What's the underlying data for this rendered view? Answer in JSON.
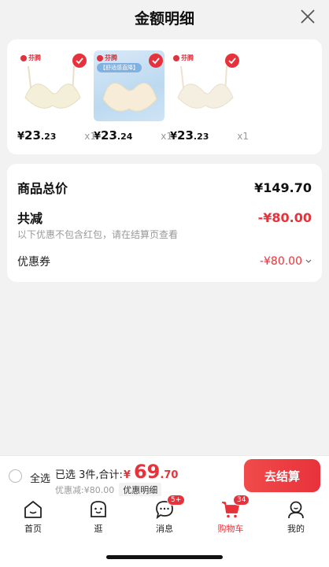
{
  "header": {
    "title": "金额明细"
  },
  "products": [
    {
      "brand": "芬腾",
      "promo": "",
      "price_symbol": "¥",
      "price_int": "23",
      "price_dec": ".23",
      "qty": "x1",
      "bg": "#ffffff"
    },
    {
      "brand": "芬腾",
      "promo": "【舒适感直降】",
      "price_symbol": "¥",
      "price_int": "23",
      "price_dec": ".24",
      "qty": "x1",
      "bg": "#cfe4f5"
    },
    {
      "brand": "芬腾",
      "promo": "",
      "price_symbol": "¥",
      "price_int": "23",
      "price_dec": ".23",
      "qty": "x1",
      "bg": "#ffffff"
    }
  ],
  "summary": {
    "goods_total_label": "商品总价",
    "goods_total_value": "¥149.70",
    "discount_label": "共减",
    "discount_value": "-¥80.00",
    "discount_note": "以下优惠不包含红包，请在结算页查看",
    "coupon_label": "优惠券",
    "coupon_value": "-¥80.00"
  },
  "bottom": {
    "select_all": "全选",
    "selected_text": "已选 3件,合计:",
    "total_symbol": "¥",
    "total_int": "69",
    "total_dec": ".70",
    "discount_text": "优惠减:¥80.00",
    "detail_button": "优惠明细",
    "checkout_button": "去结算"
  },
  "tabs": [
    {
      "label": "首页",
      "icon": "home-icon",
      "badge": ""
    },
    {
      "label": "逛",
      "icon": "face-icon",
      "badge": ""
    },
    {
      "label": "消息",
      "icon": "message-icon",
      "badge": "5+"
    },
    {
      "label": "购物车",
      "icon": "cart-icon",
      "badge": "34",
      "active": true
    },
    {
      "label": "我的",
      "icon": "profile-icon",
      "badge": ""
    }
  ],
  "colors": {
    "accent": "#e8323b",
    "background": "#f2f2f2"
  }
}
